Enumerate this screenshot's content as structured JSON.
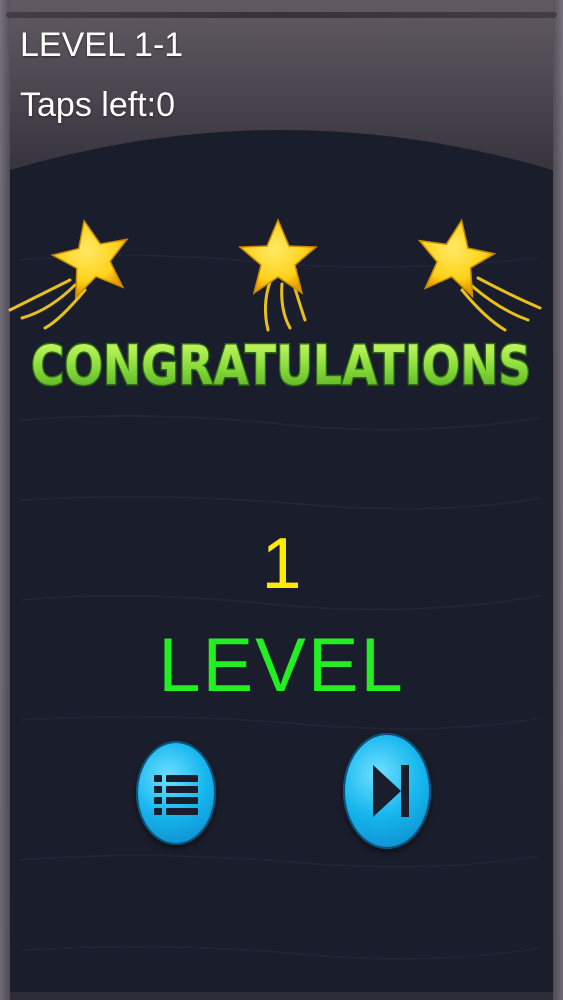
{
  "hud": {
    "level_label": "LEVEL 1-1",
    "taps_label": "Taps left:0"
  },
  "result": {
    "banner": "CONGRATULATIONS",
    "number": "1",
    "level_word": "LEVEL"
  },
  "buttons": {
    "menu_icon": "list-menu-icon",
    "next_icon": "skip-next-icon"
  },
  "colors": {
    "panel": "#1a1d2b",
    "banner_green": "#7ed957",
    "number_yellow": "#ffeb00",
    "level_green": "#22ee22",
    "button_blue": "#18b7ef",
    "star_yellow": "#ffd21a"
  }
}
